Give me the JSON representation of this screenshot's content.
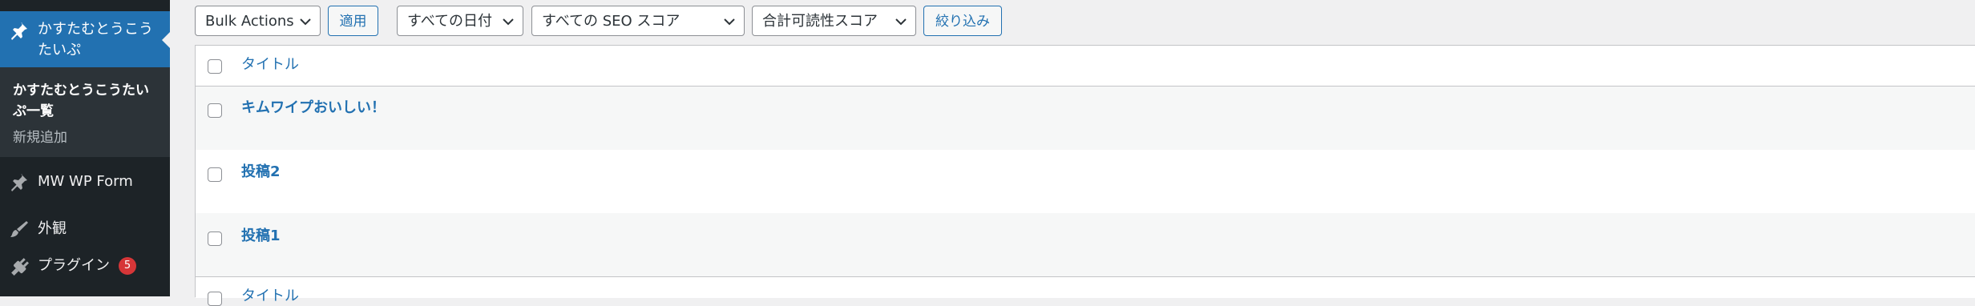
{
  "sidebar": {
    "current_menu": "かすたむとうこうたいぷ",
    "submenu": {
      "list": "かすたむとうこうたいぷ一覧",
      "add_new": "新規追加"
    },
    "items": [
      {
        "label": "MW WP Form",
        "icon": "pin-icon"
      },
      {
        "label": "外観",
        "icon": "brush-icon"
      },
      {
        "label": "プラグイン",
        "icon": "plugin-icon",
        "badge": "5"
      }
    ]
  },
  "toolbar": {
    "bulk_actions": "Bulk Actions",
    "apply": "適用",
    "date_filter": "すべての日付",
    "seo_filter": "すべての SEO スコア",
    "readability_filter": "合計可読性スコア",
    "filter": "絞り込み"
  },
  "table": {
    "header_title": "タイトル",
    "footer_title": "タイトル",
    "rows": [
      {
        "title": "キムワイプおいしい！"
      },
      {
        "title": "投稿2"
      },
      {
        "title": "投稿1"
      }
    ]
  },
  "colors": {
    "accent": "#2271b1",
    "sidebar": "#1d2327",
    "badge": "#d63638"
  }
}
